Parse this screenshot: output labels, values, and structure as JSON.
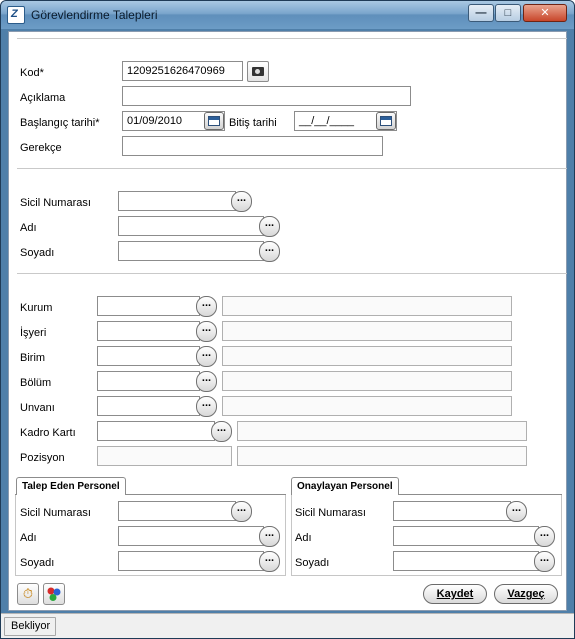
{
  "window": {
    "title": "Görevlendirme Talepleri",
    "app_icon_text": "Z",
    "minimize_glyph": "—",
    "maximize_glyph": "□",
    "close_glyph": "✕"
  },
  "header_section": {
    "kod_label": "Kod*",
    "kod_value": "1209251626470969",
    "aciklama_label": "Açıklama",
    "aciklama_value": "",
    "baslangic_label": "Başlangıç tarihi*",
    "baslangic_value": "01/09/2010",
    "bitis_label": "Bitiş tarihi",
    "bitis_value": "__/__/____",
    "gerekce_label": "Gerekçe",
    "gerekce_value": ""
  },
  "person_section": {
    "sicil_label": "Sicil Numarası",
    "adi_label": "Adı",
    "soyadi_label": "Soyadı"
  },
  "org_section": {
    "kurum_label": "Kurum",
    "isyeri_label": "İşyeri",
    "birim_label": "Birim",
    "bolum_label": "Bölüm",
    "unvani_label": "Unvanı",
    "kadro_label": "Kadro Kartı",
    "pozisyon_label": "Pozisyon"
  },
  "talep_eden": {
    "title": "Talep Eden Personel",
    "sicil_label": "Sicil Numarası",
    "adi_label": "Adı",
    "soyadi_label": "Soyadı"
  },
  "onaylayan": {
    "title": "Onaylayan Personel",
    "sicil_label": "Sicil Numarası",
    "adi_label": "Adı",
    "soyadi_label": "Soyadı"
  },
  "lookup_button_label": "...",
  "buttons": {
    "kaydet": "Kaydet",
    "vazgec": "Vazgeç"
  },
  "status": {
    "text": "Bekliyor"
  },
  "icons": {
    "timer_icon": "⏱",
    "colors_icon": "●"
  },
  "colors": {
    "title_bar": "#6c9cc6",
    "window_border": "#4f7fa9"
  }
}
